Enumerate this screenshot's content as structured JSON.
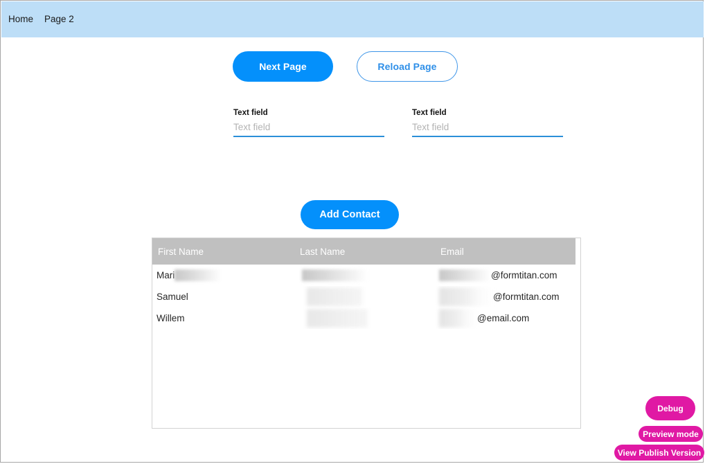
{
  "nav": {
    "items": [
      {
        "label": "Home"
      },
      {
        "label": "Page 2"
      }
    ]
  },
  "actions": {
    "next_page_label": "Next Page",
    "reload_page_label": "Reload Page",
    "add_contact_label": "Add Contact"
  },
  "fields": [
    {
      "label": "Text field",
      "value": "",
      "placeholder": "Text field"
    },
    {
      "label": "Text field",
      "value": "",
      "placeholder": "Text field"
    }
  ],
  "table": {
    "columns": [
      "First Name",
      "Last Name",
      "Email"
    ],
    "rows": [
      {
        "first_name": "Mari",
        "first_name_redacted": true,
        "last_name": "",
        "last_name_redacted": true,
        "email_local_redacted": true,
        "email_domain": "@formtitan.com"
      },
      {
        "first_name": "Samuel",
        "first_name_redacted": false,
        "last_name": "",
        "last_name_redacted": true,
        "email_local_redacted": true,
        "email_domain": "@formtitan.com"
      },
      {
        "first_name": "Willem",
        "first_name_redacted": false,
        "last_name": "",
        "last_name_redacted": true,
        "email_local_redacted": true,
        "email_domain": "@email.com"
      }
    ]
  },
  "dev_tools": {
    "debug_label": "Debug",
    "preview_mode_label": "Preview mode",
    "view_publish_label": "View Publish Version"
  },
  "colors": {
    "nav_background": "#bddef7",
    "accent_blue": "#0490fb",
    "table_header_gray": "#c0c0c0",
    "dev_magenta": "#e019a4"
  }
}
